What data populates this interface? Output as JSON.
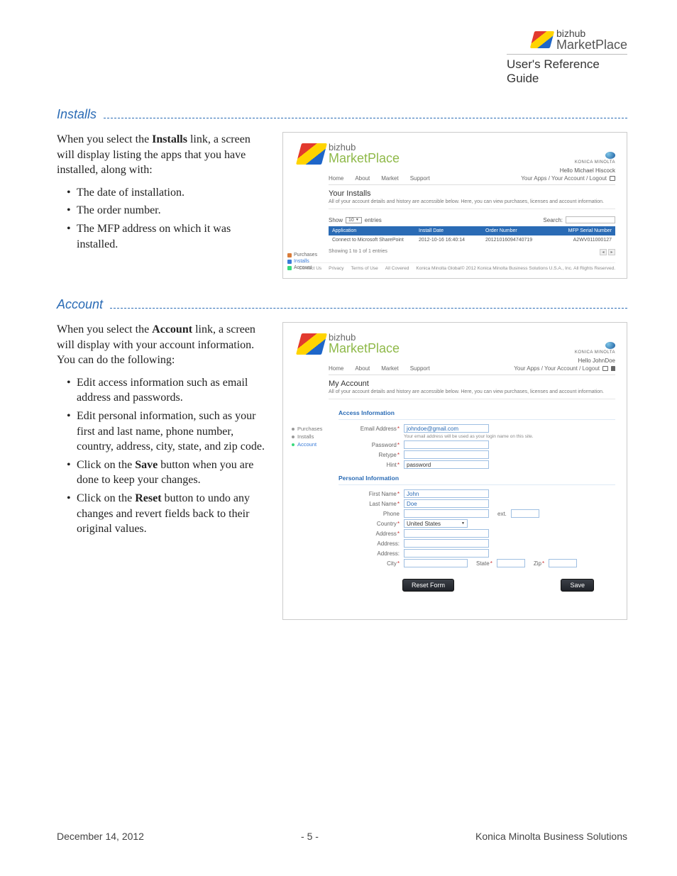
{
  "header": {
    "brand_line1": "bizhub",
    "brand_line2": "MarketPlace",
    "guide_title": "User's Reference Guide"
  },
  "sections": {
    "installs": {
      "heading": "Installs",
      "intro_pre": "When you select the ",
      "intro_bold": "Installs",
      "intro_post": " link, a screen will display listing the apps that you have installed, along with:",
      "bullets": [
        "The date of installation.",
        "The order number.",
        "The MFP address on which it was installed."
      ]
    },
    "account": {
      "heading": "Account",
      "intro_pre": "When you select the ",
      "intro_bold": "Account",
      "intro_post": " link, a screen will display with your account information. You can do the following:",
      "bullets": [
        "Edit access information such as email address and passwords.",
        "Edit personal information, such as your first and last name, phone number, country, address, city, state, and zip code.",
        "Click on the Save button when you are done to keep your changes.",
        "Click on the Reset button to undo any changes and revert fields back to their original values."
      ],
      "bold_words": {
        "2": "Save",
        "3": "Reset"
      }
    }
  },
  "shot_common": {
    "brand_l1": "bizhub",
    "brand_l2": "MarketPlace",
    "km_label": "KONICA MINOLTA",
    "nav": {
      "home": "Home",
      "about": "About",
      "market": "Market",
      "support": "Support"
    },
    "account_links_prefix": "Your Apps / Your Account / Logout",
    "sub_text": "All of your account details and history are accessible below. Here, you can view purchases, licenses and account information.",
    "footer_links": [
      "Contact Us",
      "Privacy",
      "Terms of Use",
      "All Covered",
      "Konica Minolta Global"
    ],
    "copyright": "© 2012 Konica Minolta Business Solutions U.S.A., Inc. All Rights Reserved."
  },
  "installs_shot": {
    "hello": "Hello Michael Hiscock",
    "page_title": "Your Installs",
    "show_label": "Show",
    "show_value": "10",
    "entries_label": "entries",
    "search_label": "Search:",
    "sidebar": {
      "purchases": "Purchases",
      "installs": "Installs",
      "account": "Account"
    },
    "cols": {
      "app": "Application",
      "date": "Install Date",
      "order": "Order Number",
      "serial": "MFP Serial Number"
    },
    "row": {
      "app": "Connect to Microsoft SharePoint",
      "date": "2012-10-16 16:40:14",
      "order": "20121016094740719",
      "serial": "A2WV011000127"
    },
    "showing": "Showing 1 to 1 of 1 entries"
  },
  "account_shot": {
    "hello": "Hello JohnDoe",
    "page_title": "My Account",
    "sidebar": {
      "purchases": "Purchases",
      "installs": "Installs",
      "account": "Account"
    },
    "access_title": "Access Information",
    "personal_title": "Personal Information",
    "fields": {
      "email_label": "Email Address",
      "email_value": "johndoe@gmail.com",
      "email_hint": "Your email address will be used as your login name on this site.",
      "password_label": "Password",
      "retype_label": "Retype",
      "hint_label": "Hint",
      "hint_value": "password",
      "first_label": "First Name",
      "first_value": "John",
      "last_label": "Last Name",
      "last_value": "Doe",
      "phone_label": "Phone",
      "ext_label": "ext.",
      "country_label": "Country",
      "country_value": "United States",
      "address_label": "Address",
      "address2_label": "Address:",
      "address3_label": "Address:",
      "city_label": "City",
      "state_label": "State",
      "zip_label": "Zip"
    },
    "buttons": {
      "reset": "Reset Form",
      "save": "Save"
    }
  },
  "footer": {
    "date": "December 14, 2012",
    "page": "- 5 -",
    "company": "Konica Minolta Business Solutions"
  }
}
